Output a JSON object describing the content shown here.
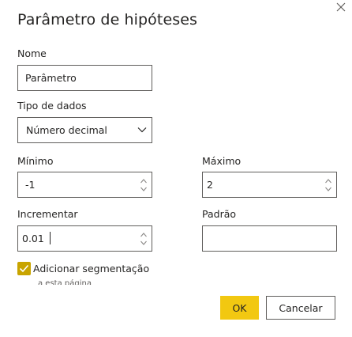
{
  "dialog": {
    "title": "Parâmetro de hipóteses",
    "close_icon": "close-icon"
  },
  "name": {
    "label": "Nome",
    "value": "Parâmetro"
  },
  "data_type": {
    "label": "Tipo de dados",
    "selected": "Número decimal",
    "icon": "chevron-down-icon"
  },
  "minimum": {
    "label": "Mínimo",
    "value": "-1"
  },
  "maximum": {
    "label": "Máximo",
    "value": "2"
  },
  "increment": {
    "label": "Incrementar",
    "value": "0.01"
  },
  "default": {
    "label": "Padrão",
    "value": ""
  },
  "slicer_checkbox": {
    "checked": true,
    "label_line1": "Adicionar segmentação",
    "label_line2": "a esta página"
  },
  "buttons": {
    "ok": "OK",
    "cancel": "Cancelar"
  },
  "colors": {
    "accent": "#f2c811",
    "checkbox": "#c8a400",
    "border": "#605e5c",
    "text": "#252423"
  }
}
